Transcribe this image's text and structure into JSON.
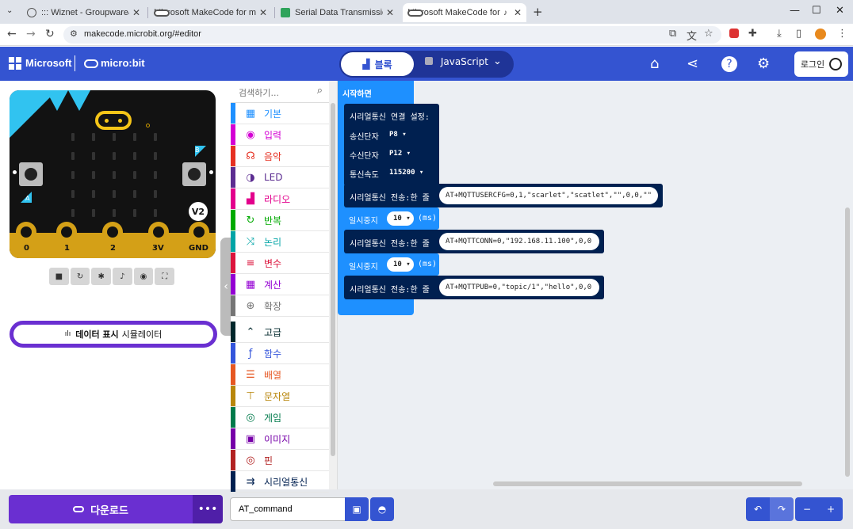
{
  "browser": {
    "tabs": [
      {
        "title": "::: Wiznet - Groupware&SCM S"
      },
      {
        "title": "Microsoft MakeCode for micro:"
      },
      {
        "title": "Serial Data Transmission Query"
      },
      {
        "title": "Microsoft MakeCode for m"
      }
    ],
    "url": "makecode.microbit.org/#editor"
  },
  "header": {
    "brand": "Microsoft",
    "product": "micro:bit",
    "blocks_label": "블록",
    "js_label": "JavaScript",
    "login_label": "로그인"
  },
  "simulator": {
    "pins": [
      "0",
      "1",
      "2",
      "3V",
      "GND"
    ],
    "badge": "V2",
    "btn_a": "A",
    "btn_b": "B",
    "data_btn_strong": "데이터 표시",
    "data_btn_rest": "시뮬레이터"
  },
  "toolbox": {
    "search_placeholder": "검색하기...",
    "categories": [
      {
        "label": "기본",
        "color": "#1e90ff",
        "icon": "grid-icon"
      },
      {
        "label": "입력",
        "color": "#d400d4",
        "icon": "input-icon"
      },
      {
        "label": "음악",
        "color": "#e63022",
        "icon": "headphones-icon"
      },
      {
        "label": "LED",
        "color": "#5c2d91",
        "icon": "toggle-icon"
      },
      {
        "label": "라디오",
        "color": "#e3008c",
        "icon": "signal-icon"
      },
      {
        "label": "반복",
        "color": "#00aa00",
        "icon": "loop-icon"
      },
      {
        "label": "논리",
        "color": "#00a4a6",
        "icon": "shuffle-icon"
      },
      {
        "label": "변수",
        "color": "#dc143c",
        "icon": "list-icon"
      },
      {
        "label": "계산",
        "color": "#9400d3",
        "icon": "calculator-icon"
      },
      {
        "label": "확장",
        "color": "#757575",
        "icon": "plus-icon"
      },
      {
        "label": "고급",
        "color": "#00272b",
        "icon": "chevron-up-icon"
      },
      {
        "label": "함수",
        "color": "#3455db",
        "icon": "function-icon"
      },
      {
        "label": "배열",
        "color": "#e65722",
        "icon": "array-icon"
      },
      {
        "label": "문자열",
        "color": "#b8860b",
        "icon": "text-icon"
      },
      {
        "label": "게임",
        "color": "#007a4b",
        "icon": "gamepad-icon"
      },
      {
        "label": "이미지",
        "color": "#7600a8",
        "icon": "image-icon"
      },
      {
        "label": "핀",
        "color": "#b22222",
        "icon": "pin-icon"
      },
      {
        "label": "시리얼통신",
        "color": "#002050",
        "icon": "usb-icon"
      }
    ]
  },
  "workspace": {
    "on_start": "시작하면",
    "serial_redirect": "시리얼통신 연결 설정:",
    "tx_label": "송신단자",
    "tx_value": "P8",
    "rx_label": "수신단자",
    "rx_value": "P12",
    "baud_label": "통신속도",
    "baud_value": "115200",
    "write_line_label": "시리얼통신 전송:한 줄",
    "pause_label": "일시중지",
    "ms_label": "(ms)",
    "line1": "AT+MQTTUSERCFG=0,1,\"scarlet\",\"scatlet\",\"\",0,0,\"\"",
    "pause1": "10",
    "line2": "AT+MQTTCONN=0,\"192.168.11.100\",0,0",
    "pause2": "10",
    "line3": "AT+MQTTPUB=0,\"topic/1\",\"hello\",0,0"
  },
  "footer": {
    "download_label": "다운로드",
    "more_label": "•••",
    "project_name": "AT_command"
  },
  "colors": {
    "header": "#3454d1",
    "download": "#6a2fd1",
    "serial_block": "#002050",
    "events_block": "#1e90ff"
  }
}
